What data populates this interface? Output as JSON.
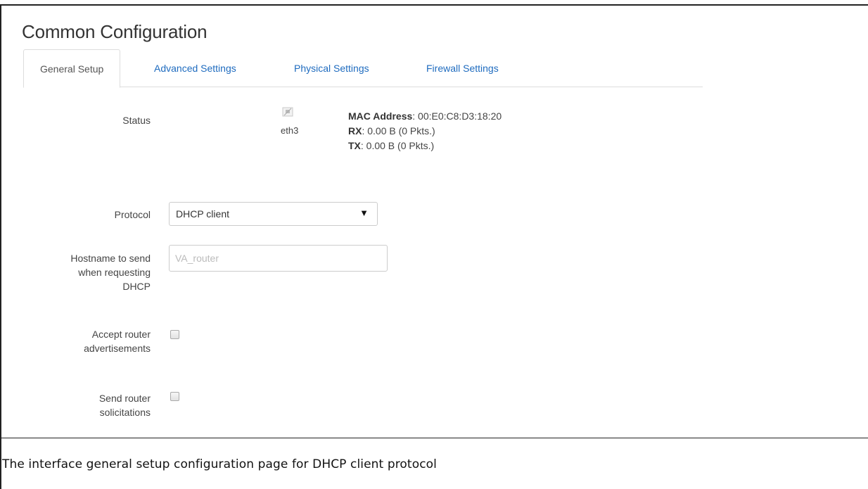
{
  "page": {
    "title": "Common Configuration",
    "caption": "The interface general setup configuration page for DHCP client protocol"
  },
  "tabs": [
    {
      "label": "General Setup",
      "active": true
    },
    {
      "label": "Advanced Settings",
      "active": false
    },
    {
      "label": "Physical Settings",
      "active": false
    },
    {
      "label": "Firewall Settings",
      "active": false
    }
  ],
  "status": {
    "label": "Status",
    "interface": "eth3",
    "icon": "network-port-icon",
    "mac_label": "MAC Address",
    "mac_value": ": 00:E0:C8:D3:18:20",
    "rx_label": "RX",
    "rx_value": ": 0.00 B (0 Pkts.)",
    "tx_label": "TX",
    "tx_value": ": 0.00 B (0 Pkts.)"
  },
  "protocol": {
    "label": "Protocol",
    "selected": "DHCP client",
    "arrow": "▼"
  },
  "hostname": {
    "label_line1": "Hostname to send",
    "label_line2": "when requesting",
    "label_line3": "DHCP",
    "placeholder": "VA_router",
    "value": ""
  },
  "accept_ra": {
    "label_line1": "Accept router",
    "label_line2": "advertisements",
    "checked": false
  },
  "send_rs": {
    "label_line1": "Send router",
    "label_line2": "solicitations",
    "checked": false
  }
}
